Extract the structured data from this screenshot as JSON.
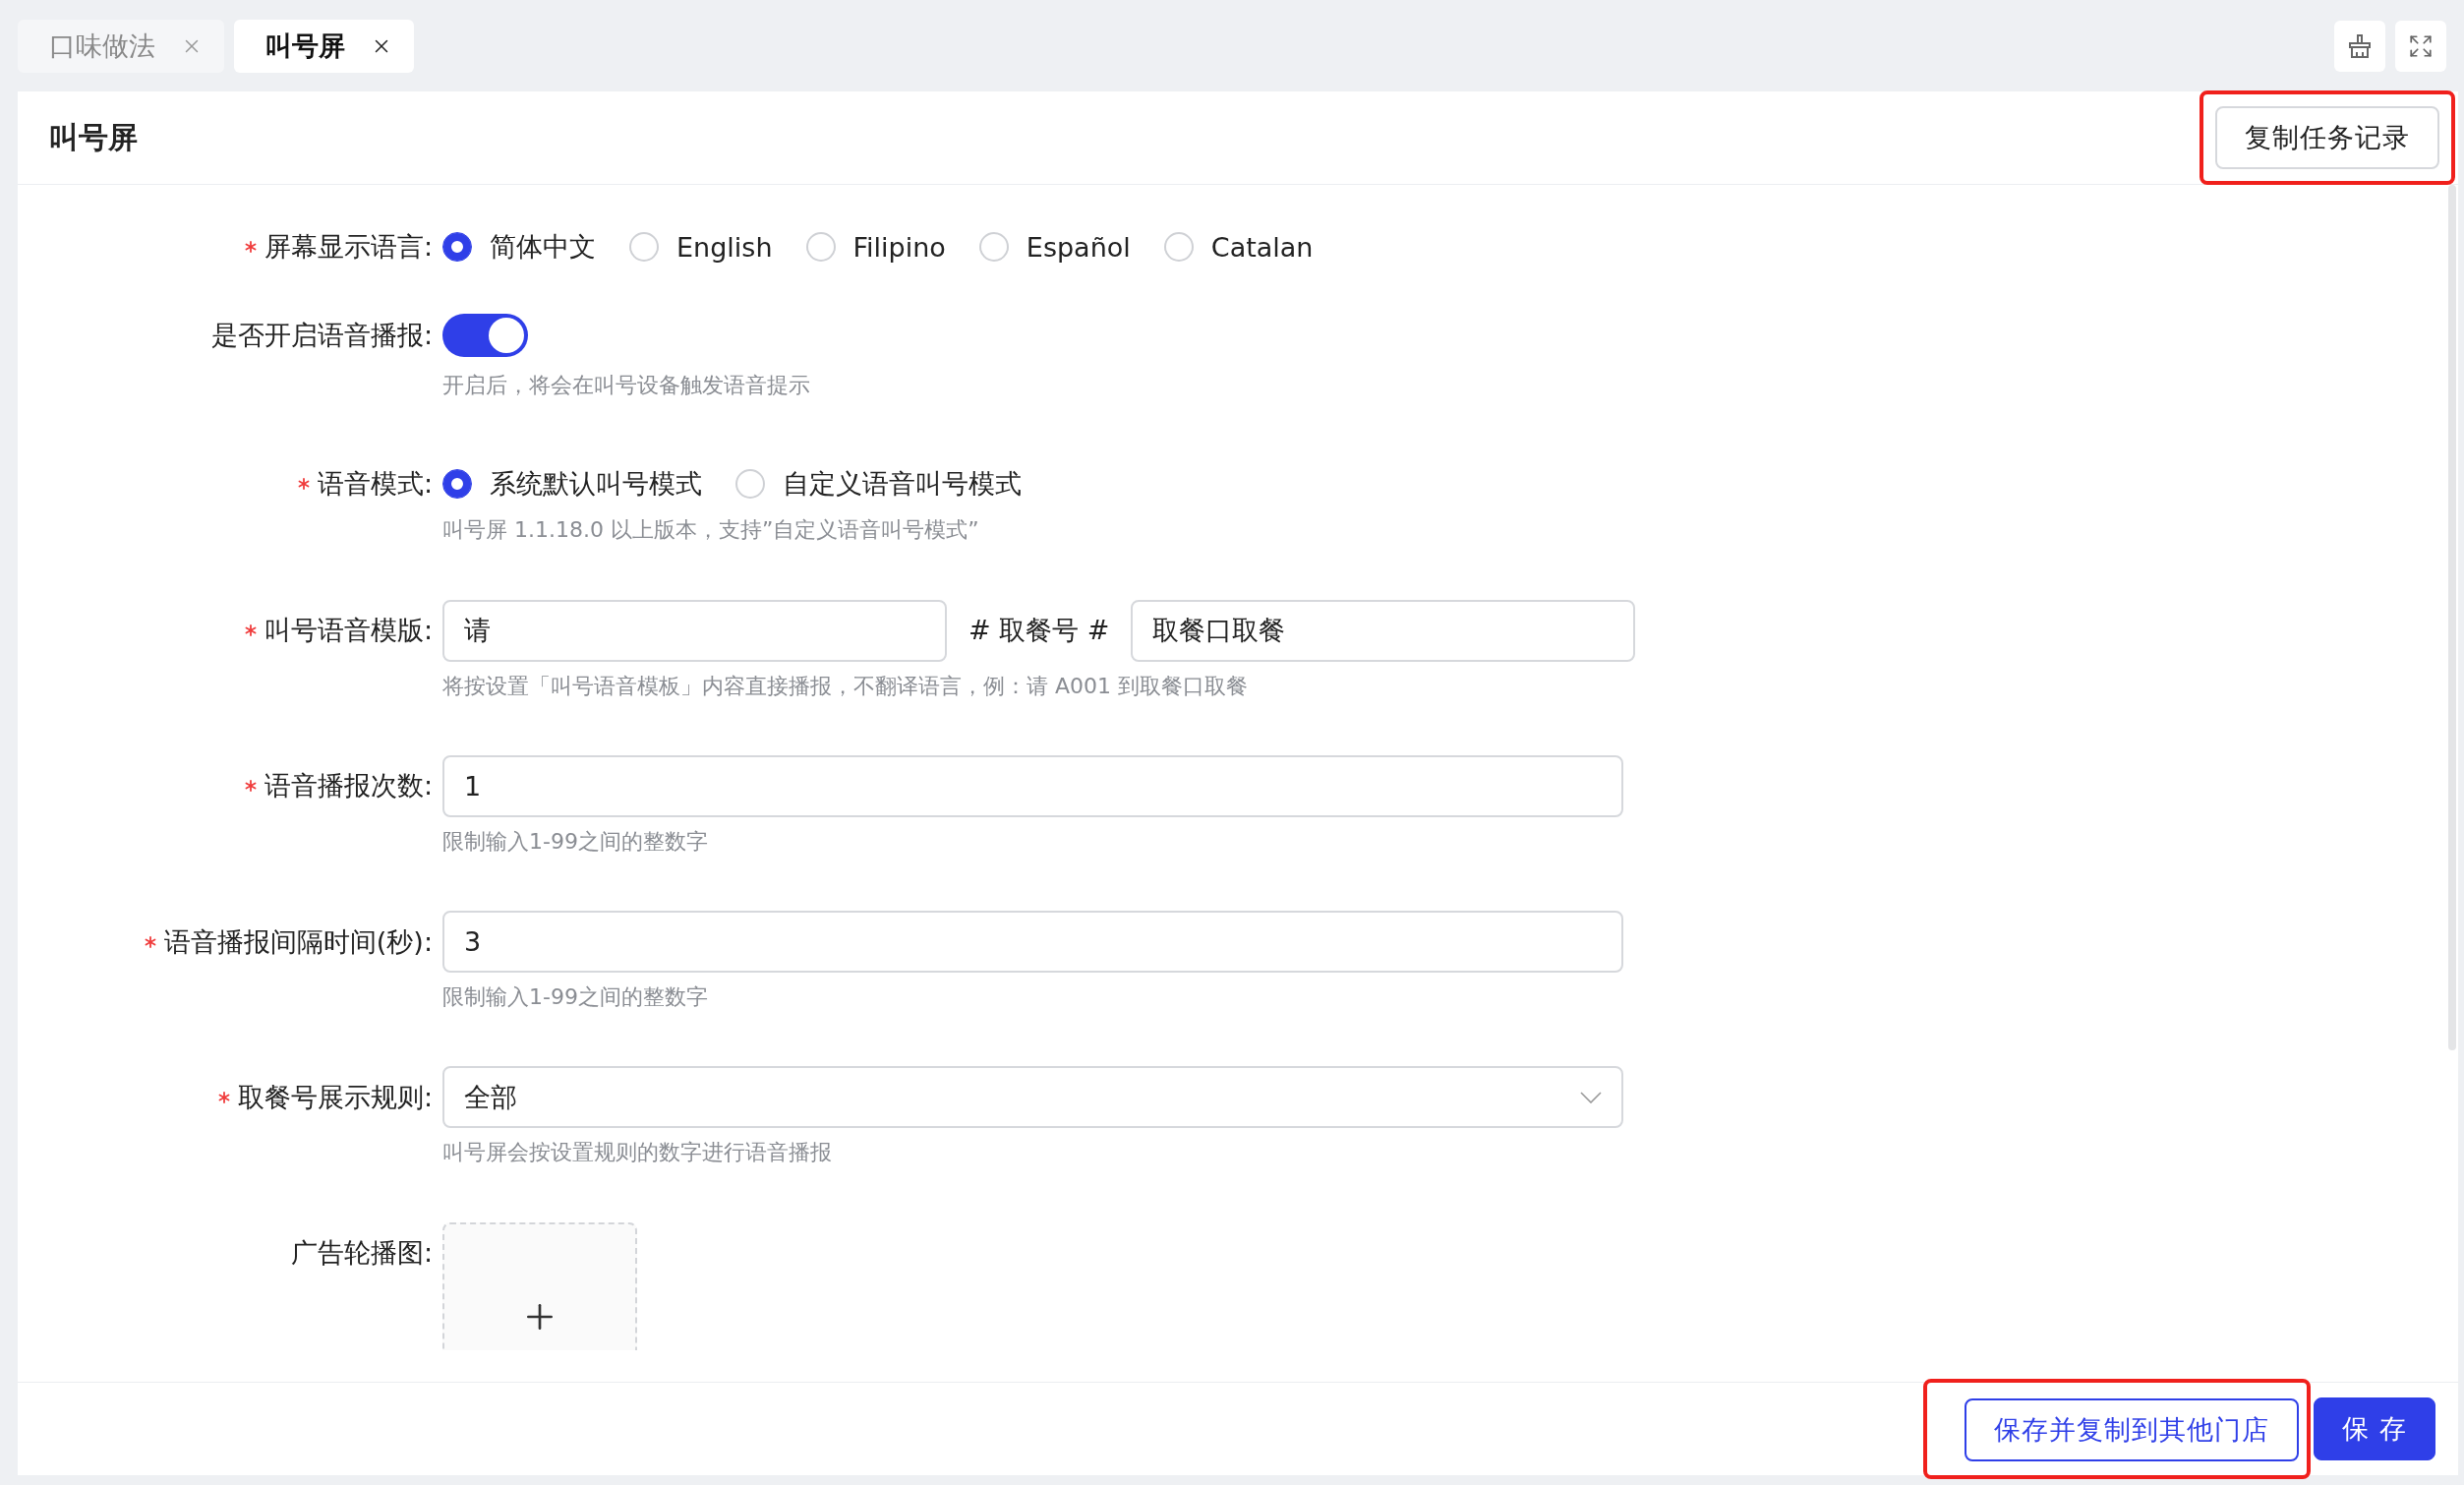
{
  "tabs": [
    {
      "label": "口味做法",
      "selected": false
    },
    {
      "label": "叫号屏",
      "selected": true
    }
  ],
  "page": {
    "title": "叫号屏",
    "header_button": {
      "label": "复制任务记录",
      "highlighted": true
    }
  },
  "form": {
    "fields": [
      {
        "kind": "radio",
        "label": "屏幕显示语言:",
        "required": true,
        "options": [
          {
            "label": "简体中文",
            "selected": true
          },
          {
            "label": "English",
            "selected": false
          },
          {
            "label": "Filipino",
            "selected": false
          },
          {
            "label": "Español",
            "selected": false
          },
          {
            "label": "Catalan",
            "selected": false
          }
        ]
      },
      {
        "kind": "switch",
        "label": "是否开启语音播报:",
        "required": false,
        "on": true,
        "hint": "开启后，将会在叫号设备触发语音提示"
      },
      {
        "kind": "radio",
        "label": "语音模式:",
        "required": true,
        "options": [
          {
            "label": "系统默认叫号模式",
            "selected": true
          },
          {
            "label": "自定义语音叫号模式",
            "selected": false
          }
        ],
        "hint": "叫号屏 1.1.18.0 以上版本，支持”自定义语音叫号模式”"
      },
      {
        "kind": "template",
        "label": "叫号语音模版:",
        "required": true,
        "value": "请",
        "middle": "# 取餐号 #",
        "value_2": "取餐口取餐",
        "hint": "将按设置「叫号语音模板」内容直接播报，不翻译语言，例：请 A001 到取餐口取餐"
      },
      {
        "kind": "input",
        "label": "语音播报次数:",
        "required": true,
        "value": "1",
        "hint": "限制输入1-99之间的整数字"
      },
      {
        "kind": "input",
        "label": "语音播报间隔时间(秒):",
        "required": true,
        "value": "3",
        "hint": "限制输入1-99之间的整数字"
      },
      {
        "kind": "select",
        "label": "取餐号展示规则:",
        "required": true,
        "value": "全部",
        "hint": "叫号屏会按设置规则的数字进行语音播报"
      },
      {
        "kind": "upload",
        "label": "广告轮播图:",
        "required": false
      }
    ]
  },
  "footer": {
    "buttons": [
      {
        "label": "保存并复制到其他门店",
        "kind": "outline",
        "highlighted": true
      },
      {
        "label": "保 存",
        "kind": "primary",
        "highlighted": false
      }
    ]
  }
}
